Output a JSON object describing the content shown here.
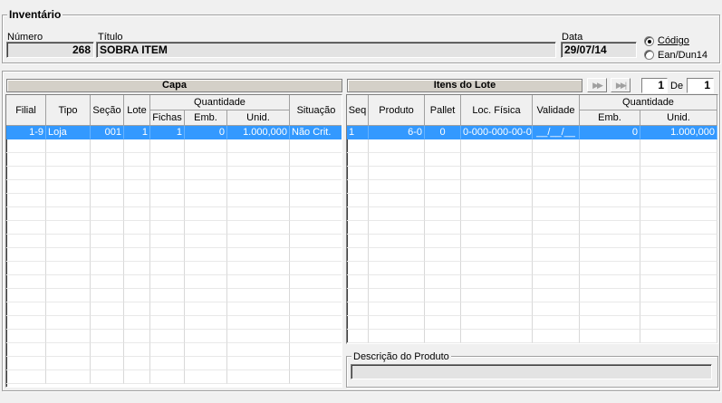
{
  "inventario": {
    "title": "Inventário",
    "numero_label": "Número",
    "numero_value": "268",
    "titulo_label": "Título",
    "titulo_value": "SOBRA ITEM",
    "data_label": "Data",
    "data_value": "29/07/14",
    "radio_codigo": "Código",
    "radio_ean": "Ean/Dun14",
    "radio_selected": "Código"
  },
  "capa": {
    "title": "Capa",
    "headers": {
      "filial": "Filial",
      "tipo": "Tipo",
      "secao": "Seção",
      "lote": "Lote",
      "quantidade": "Quantidade",
      "fichas": "Fichas",
      "emb": "Emb.",
      "unid": "Unid.",
      "situacao": "Situação"
    },
    "rows": [
      {
        "filial": "1-9",
        "tipo": "Loja",
        "secao": "001",
        "lote": "1",
        "fichas": "1",
        "emb": "0",
        "unid": "1.000,000",
        "situacao": "Não Crit."
      }
    ]
  },
  "itens": {
    "title": "Itens do Lote",
    "page_current": "1",
    "page_of": "De",
    "page_total": "1",
    "headers": {
      "seq": "Seq",
      "produto": "Produto",
      "pallet": "Pallet",
      "loc": "Loc. Física",
      "validade": "Validade",
      "quantidade": "Quantidade",
      "emb": "Emb.",
      "unid": "Unid."
    },
    "rows": [
      {
        "seq": "1",
        "produto": "6-0",
        "pallet": "0",
        "loc": "0-000-000-00-0",
        "validade": "__/__/__",
        "emb": "0",
        "unid": "1.000,000"
      }
    ]
  },
  "descricao": {
    "title": "Descrição do Produto",
    "value": ""
  },
  "icons": {
    "next": "next-page-icon",
    "last": "last-page-icon"
  },
  "colors": {
    "selection": "#3399ff",
    "background": "#f0f0f0"
  }
}
